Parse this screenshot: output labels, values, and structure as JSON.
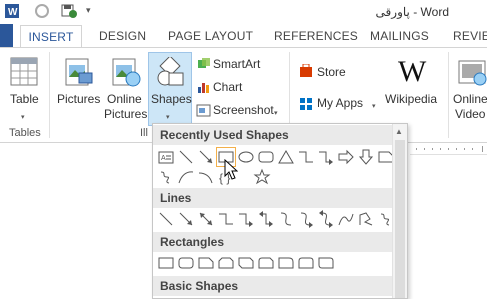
{
  "window": {
    "title": "پاورقی - Word"
  },
  "tabs": [
    {
      "label": "INSERT",
      "active": true
    },
    {
      "label": "DESIGN"
    },
    {
      "label": "PAGE LAYOUT"
    },
    {
      "label": "REFERENCES"
    },
    {
      "label": "MAILINGS"
    },
    {
      "label": "REVIEW"
    }
  ],
  "ribbon": {
    "table": {
      "label": "Table"
    },
    "pictures": {
      "label": "Pictures"
    },
    "online_pictures": {
      "line1": "Online",
      "line2": "Pictures"
    },
    "shapes": {
      "label": "Shapes"
    },
    "smartart": {
      "label": "SmartArt"
    },
    "chart": {
      "label": "Chart"
    },
    "screenshot": {
      "label": "Screenshot"
    },
    "store": {
      "label": "Store"
    },
    "my_apps": {
      "label": "My Apps"
    },
    "wikipedia": {
      "label": "Wikipedia"
    },
    "online_video": {
      "line1": "Online",
      "line2": "Video"
    },
    "groups": {
      "tables": "Tables",
      "illustrations": "Ill"
    }
  },
  "shapes_panel": {
    "sections": {
      "recent": "Recently Used Shapes",
      "lines": "Lines",
      "rectangles": "Rectangles",
      "basic": "Basic Shapes"
    },
    "wiki_glyph": "W"
  },
  "colors": {
    "accent": "#2b579a",
    "store_red": "#d83b01",
    "apps_blue": "#0072c6",
    "selection": "#cde6f7"
  }
}
